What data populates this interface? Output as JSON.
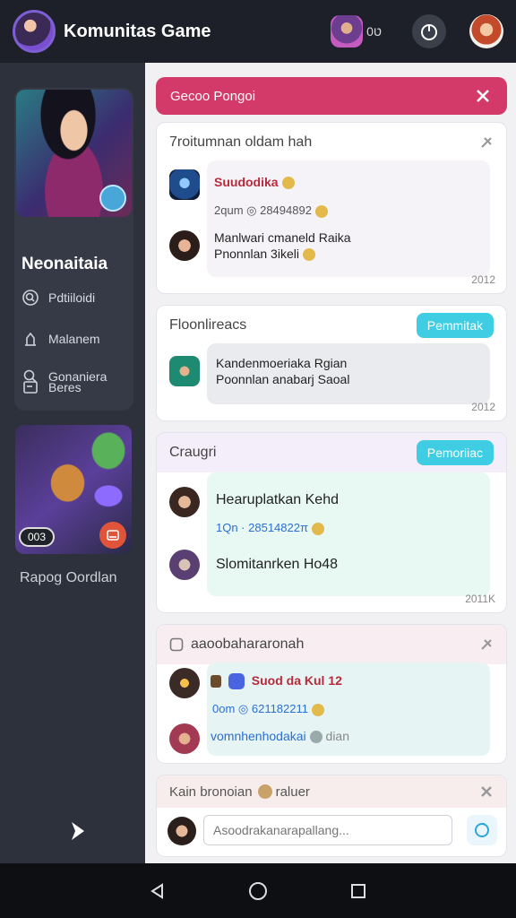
{
  "header": {
    "title": "Komunitas Game",
    "chip_text": "ט0"
  },
  "sidebar": {
    "hero_name": "Neonaitaia",
    "items": [
      {
        "label": "Pdtiiloidi",
        "icon": "search-circle-icon"
      },
      {
        "label": "Malanem",
        "icon": "person-icon"
      },
      {
        "label": "Gonaniera",
        "icon": "search-icon"
      },
      {
        "label": "Beres",
        "icon": "box-icon"
      }
    ],
    "card2_chip": "003",
    "card2_caption": "Rapog Oordlan"
  },
  "alert": {
    "text": "Gecoo Pongoi"
  },
  "cards": [
    {
      "title": "7roitumnan oldam hah",
      "messages": [
        {
          "text": "Suudodika",
          "sub": "2qum ◎ 28494892"
        },
        {
          "text": "Manlwari cmaneld Raika",
          "sub": "Pnonnlan 3ikeli"
        }
      ],
      "stamp": "2012"
    },
    {
      "title": "Floonlireacs",
      "pill": "Pemmitak",
      "messages": [
        {
          "text": "Kandenmoeriaka Rgian",
          "sub": "Poonnlan anabarj Saoal"
        }
      ],
      "stamp": "2012"
    },
    {
      "title": "Craugri",
      "pill": "Pemoriiac",
      "messages": [
        {
          "text": "Hearuplatkan Kehd",
          "sub": "1Qn · 28514822π"
        },
        {
          "text": "Slomitanrken Ho48",
          "sub": ""
        }
      ],
      "stamp": "2011K"
    },
    {
      "title": "aaoobahararonah",
      "messages": [
        {
          "text": "Suod da Kul 12",
          "sub": "0om ◎ 621182211"
        },
        {
          "text": "vomnhenhodakai",
          "sub": "dian"
        }
      ],
      "stamp": ""
    }
  ],
  "composer": {
    "title": "Kain bronoian",
    "title_suffix": "raluer",
    "placeholder": "Asoodrakanarapallang..."
  },
  "colors": {
    "accent": "#d33a69",
    "pill": "#3fcde3",
    "sidebar": "#2d313c",
    "topbar": "#1d2029"
  }
}
